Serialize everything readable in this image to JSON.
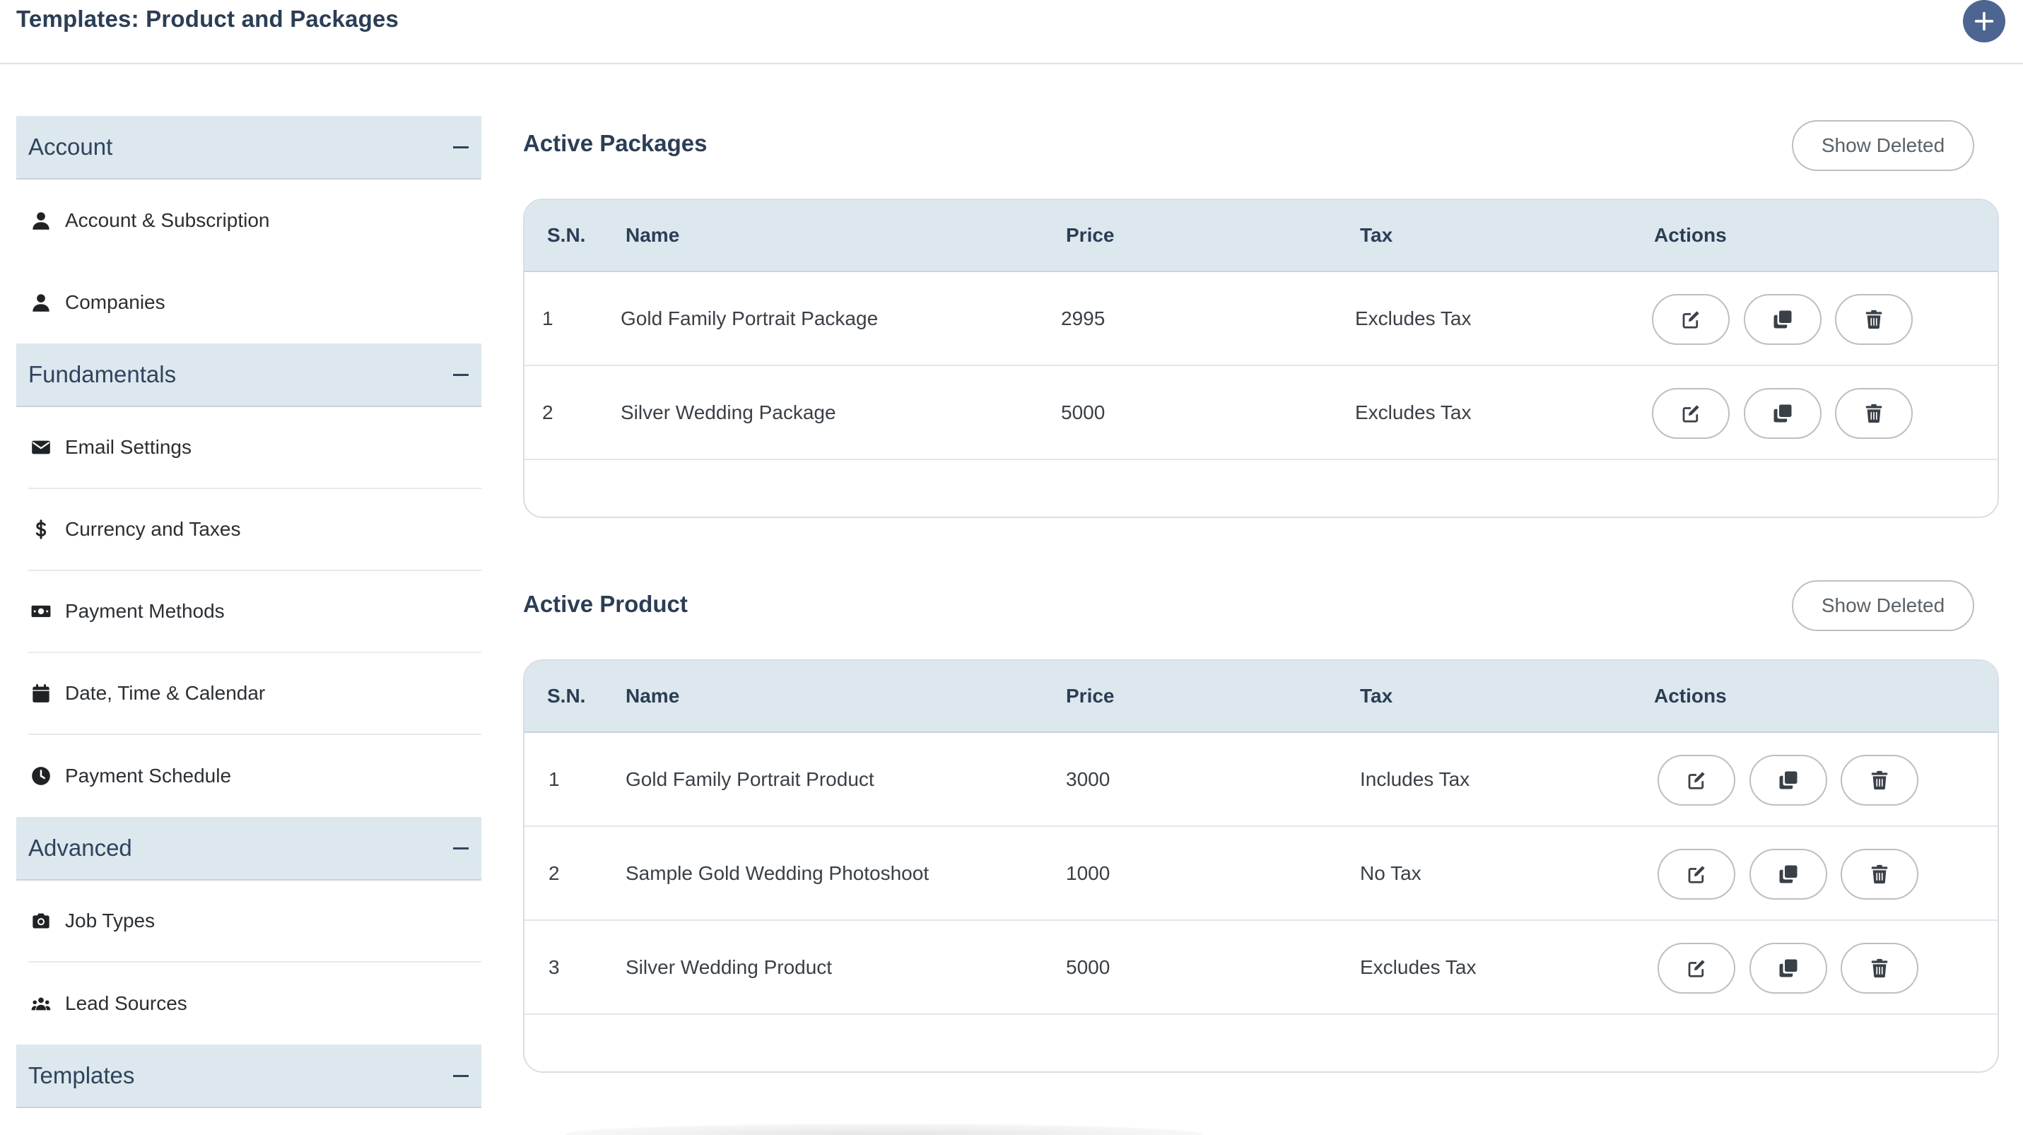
{
  "header": {
    "title": "Templates: Product and Packages",
    "add_icon": "plus-icon",
    "accent": "#4d6591"
  },
  "sidebar": {
    "sections": [
      {
        "label": "Account",
        "items": [
          {
            "label": "Account & Subscription",
            "icon": "user-icon"
          },
          {
            "label": "Companies",
            "icon": "user-icon"
          }
        ]
      },
      {
        "label": "Fundamentals",
        "items": [
          {
            "label": "Email Settings",
            "icon": "envelope-icon"
          },
          {
            "label": "Currency and Taxes",
            "icon": "dollar-icon"
          },
          {
            "label": "Payment Methods",
            "icon": "money-bill-icon"
          },
          {
            "label": "Date, Time & Calendar",
            "icon": "calendar-icon"
          },
          {
            "label": "Payment Schedule",
            "icon": "clock-icon"
          }
        ]
      },
      {
        "label": "Advanced",
        "items": [
          {
            "label": "Job Types",
            "icon": "camera-icon"
          },
          {
            "label": "Lead Sources",
            "icon": "users-icon"
          }
        ]
      },
      {
        "label": "Templates",
        "items": []
      }
    ]
  },
  "packages": {
    "title": "Active Packages",
    "show_deleted": "Show Deleted",
    "columns": [
      "S.N.",
      "Name",
      "Price",
      "Tax",
      "Actions"
    ],
    "rows": [
      {
        "sn": "1",
        "name": "Gold Family Portrait Package",
        "price": "2995",
        "tax": "Excludes Tax"
      },
      {
        "sn": "2",
        "name": "Silver Wedding Package",
        "price": "5000",
        "tax": "Excludes Tax"
      }
    ]
  },
  "products": {
    "title": "Active Product",
    "show_deleted": "Show Deleted",
    "columns": [
      "S.N.",
      "Name",
      "Price",
      "Tax",
      "Actions"
    ],
    "rows": [
      {
        "sn": "1",
        "name": "Gold Family Portrait Product",
        "price": "3000",
        "tax": "Includes Tax"
      },
      {
        "sn": "2",
        "name": "Sample Gold Wedding Photoshoot",
        "price": "1000",
        "tax": "No Tax"
      },
      {
        "sn": "3",
        "name": "Silver Wedding Product",
        "price": "5000",
        "tax": "Excludes Tax"
      }
    ]
  },
  "row_actions": [
    "edit-icon",
    "copy-icon",
    "trash-icon"
  ]
}
